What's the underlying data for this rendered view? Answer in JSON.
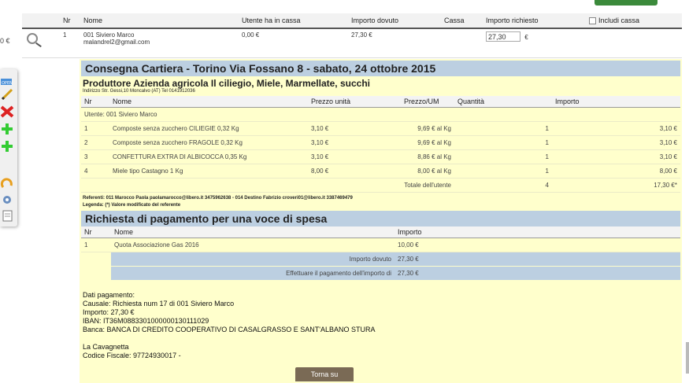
{
  "left": {
    "amount": "0 €"
  },
  "top_table": {
    "headers": {
      "nr": "Nr",
      "nome": "Nome",
      "utente_cassa": "Utente ha in cassa",
      "importo_dovuto": "Importo dovuto",
      "cassa": "Cassa",
      "importo_richiesto": "Importo richiesto",
      "includi_cassa": "Includi cassa"
    },
    "row": {
      "nr": "1",
      "name": "001 Siviero Marco",
      "email": "malandrel2@gmail.com",
      "utente_cassa": "0,00 €",
      "importo_dovuto": "27,30 €",
      "importo_richiesto": "27,30",
      "currency": "€"
    }
  },
  "consegna": {
    "title": "Consegna Cartiera - Torino Via Fossano 8 - sabato, 24 ottobre 2015",
    "producer": "Produttore Azienda agricola Il ciliegio, Miele, Marmellate, succhi",
    "address": "Indirizzo Str. Gessi,10 Moncalvo (AT) Tel 0141912036",
    "headers": {
      "nr": "Nr",
      "nome": "Nome",
      "prezzo_unita": "Prezzo unità",
      "prezzo_um": "Prezzo/UM",
      "quantita": "Quantità",
      "importo": "Importo"
    },
    "utente": "Utente: 001 Siviero Marco",
    "items": [
      {
        "nr": "1",
        "nome": "Composte senza zucchero CILIEGIE 0,32 Kg",
        "prezzo": "3,10 €",
        "prezzo_um": "9,69 € al Kg",
        "qta": "1",
        "importo": "3,10 €"
      },
      {
        "nr": "2",
        "nome": "Composte senza zucchero FRAGOLE 0,32 Kg",
        "prezzo": "3,10 €",
        "prezzo_um": "9,69 € al Kg",
        "qta": "1",
        "importo": "3,10 €"
      },
      {
        "nr": "3",
        "nome": "CONFETTURA EXTRA DI ALBICOCCA 0,35 Kg",
        "prezzo": "3,10 €",
        "prezzo_um": "8,86 € al Kg",
        "qta": "1",
        "importo": "3,10 €"
      },
      {
        "nr": "4",
        "nome": "Miele tipo Castagno 1 Kg",
        "prezzo": "8,00 €",
        "prezzo_um": "8,00 € al Kg",
        "qta": "1",
        "importo": "8,00 €"
      }
    ],
    "totale_label": "Totale dell'utente",
    "totale_qta": "4",
    "totale_importo": "17,30 €*",
    "referenti": "Referenti: 011 Marocco Paola paolamarocco@libero.it 3475962638 - 014 Destino Fabrizio croveri01@libero.it 3387469479",
    "legenda": "Legenda: (*) Valore modificato del referente"
  },
  "pagamento": {
    "title": "Richiesta di pagamento per una voce di spesa",
    "headers": {
      "nr": "Nr",
      "nome": "Nome",
      "importo": "Importo"
    },
    "row": {
      "nr": "1",
      "nome": "Quota Associazione Gas 2016",
      "importo": "10,00 €"
    },
    "importo_dovuto_label": "Importo dovuto",
    "importo_dovuto": "27,30 €",
    "effettuare_label": "Effettuare il pagamento dell'importo di",
    "effettuare": "27,30 €"
  },
  "dati": {
    "heading": "Dati pagamento:",
    "causale": "Causale: Richiesta num 17 di 001 Siviero Marco",
    "importo": "Importo: 27,30 €",
    "iban": "IBAN: IT36M0883301000000130111029",
    "banca": "Banca: BANCA DI CREDITO COOPERATIVO DI CASALGRASSO E SANT'ALBANO STURA",
    "org": "La Cavagnetta",
    "cf": "Codice Fiscale: 97724930017 -"
  },
  "torna_su": "Torna su"
}
